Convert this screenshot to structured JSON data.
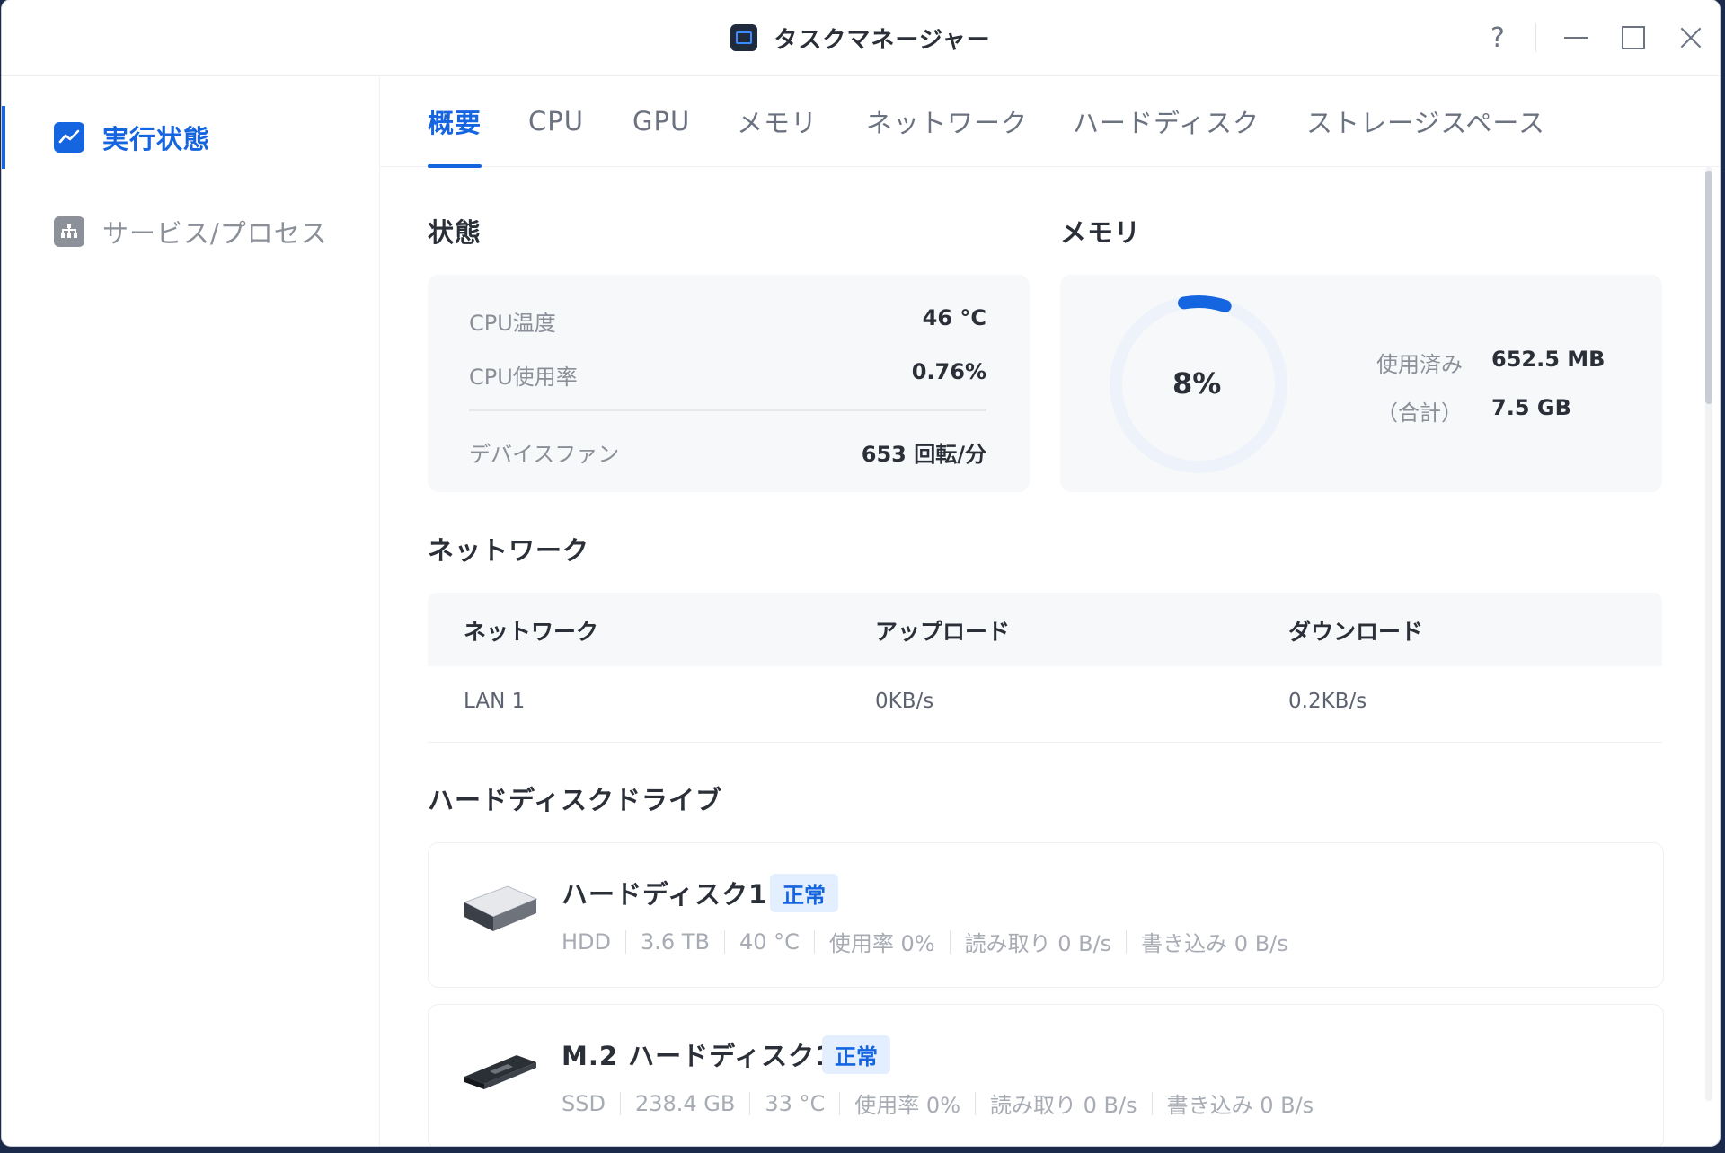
{
  "window": {
    "title": "タスクマネージャー",
    "help": "?"
  },
  "sidebar": {
    "items": [
      {
        "label": "実行状態",
        "icon": "chart-line-icon",
        "active": true
      },
      {
        "label": "サービス/プロセス",
        "icon": "process-icon",
        "active": false
      }
    ]
  },
  "tabs": [
    {
      "label": "概要",
      "active": true
    },
    {
      "label": "CPU"
    },
    {
      "label": "GPU"
    },
    {
      "label": "メモリ"
    },
    {
      "label": "ネットワーク"
    },
    {
      "label": "ハードディスク"
    },
    {
      "label": "ストレージスペース"
    }
  ],
  "status": {
    "title": "状態",
    "rows": [
      {
        "label": "CPU温度",
        "value": "46 °C"
      },
      {
        "label": "CPU使用率",
        "value": "0.76%"
      },
      {
        "label": "デバイスファン",
        "value": "653 回転/分"
      }
    ]
  },
  "memory": {
    "title": "メモリ",
    "percent_text": "8%",
    "percent": 8,
    "used_label": "使用済み",
    "used_value": "652.5 MB",
    "total_label": "（合計）",
    "total_value": "7.5 GB",
    "ring_color": "#1565e0",
    "ring_track": "#eef3fb"
  },
  "network": {
    "title": "ネットワーク",
    "headers": [
      "ネットワーク",
      "アップロード",
      "ダウンロード"
    ],
    "rows": [
      [
        "LAN 1",
        "0KB/s",
        "0.2KB/s"
      ]
    ]
  },
  "disks": {
    "title": "ハードディスクドライブ",
    "items": [
      {
        "name": "ハードディスク1",
        "status": "正常",
        "type": "HDD",
        "size": "3.6 TB",
        "temp": "40 °C",
        "usage": "使用率 0%",
        "read": "読み取り 0 B/s",
        "write": "書き込み 0 B/s",
        "icon": "hdd-icon"
      },
      {
        "name": "M.2 ハードディスク1",
        "status": "正常",
        "type": "SSD",
        "size": "238.4 GB",
        "temp": "33 °C",
        "usage": "使用率 0%",
        "read": "読み取り 0 B/s",
        "write": "書き込み 0 B/s",
        "icon": "ssd-icon"
      }
    ]
  }
}
